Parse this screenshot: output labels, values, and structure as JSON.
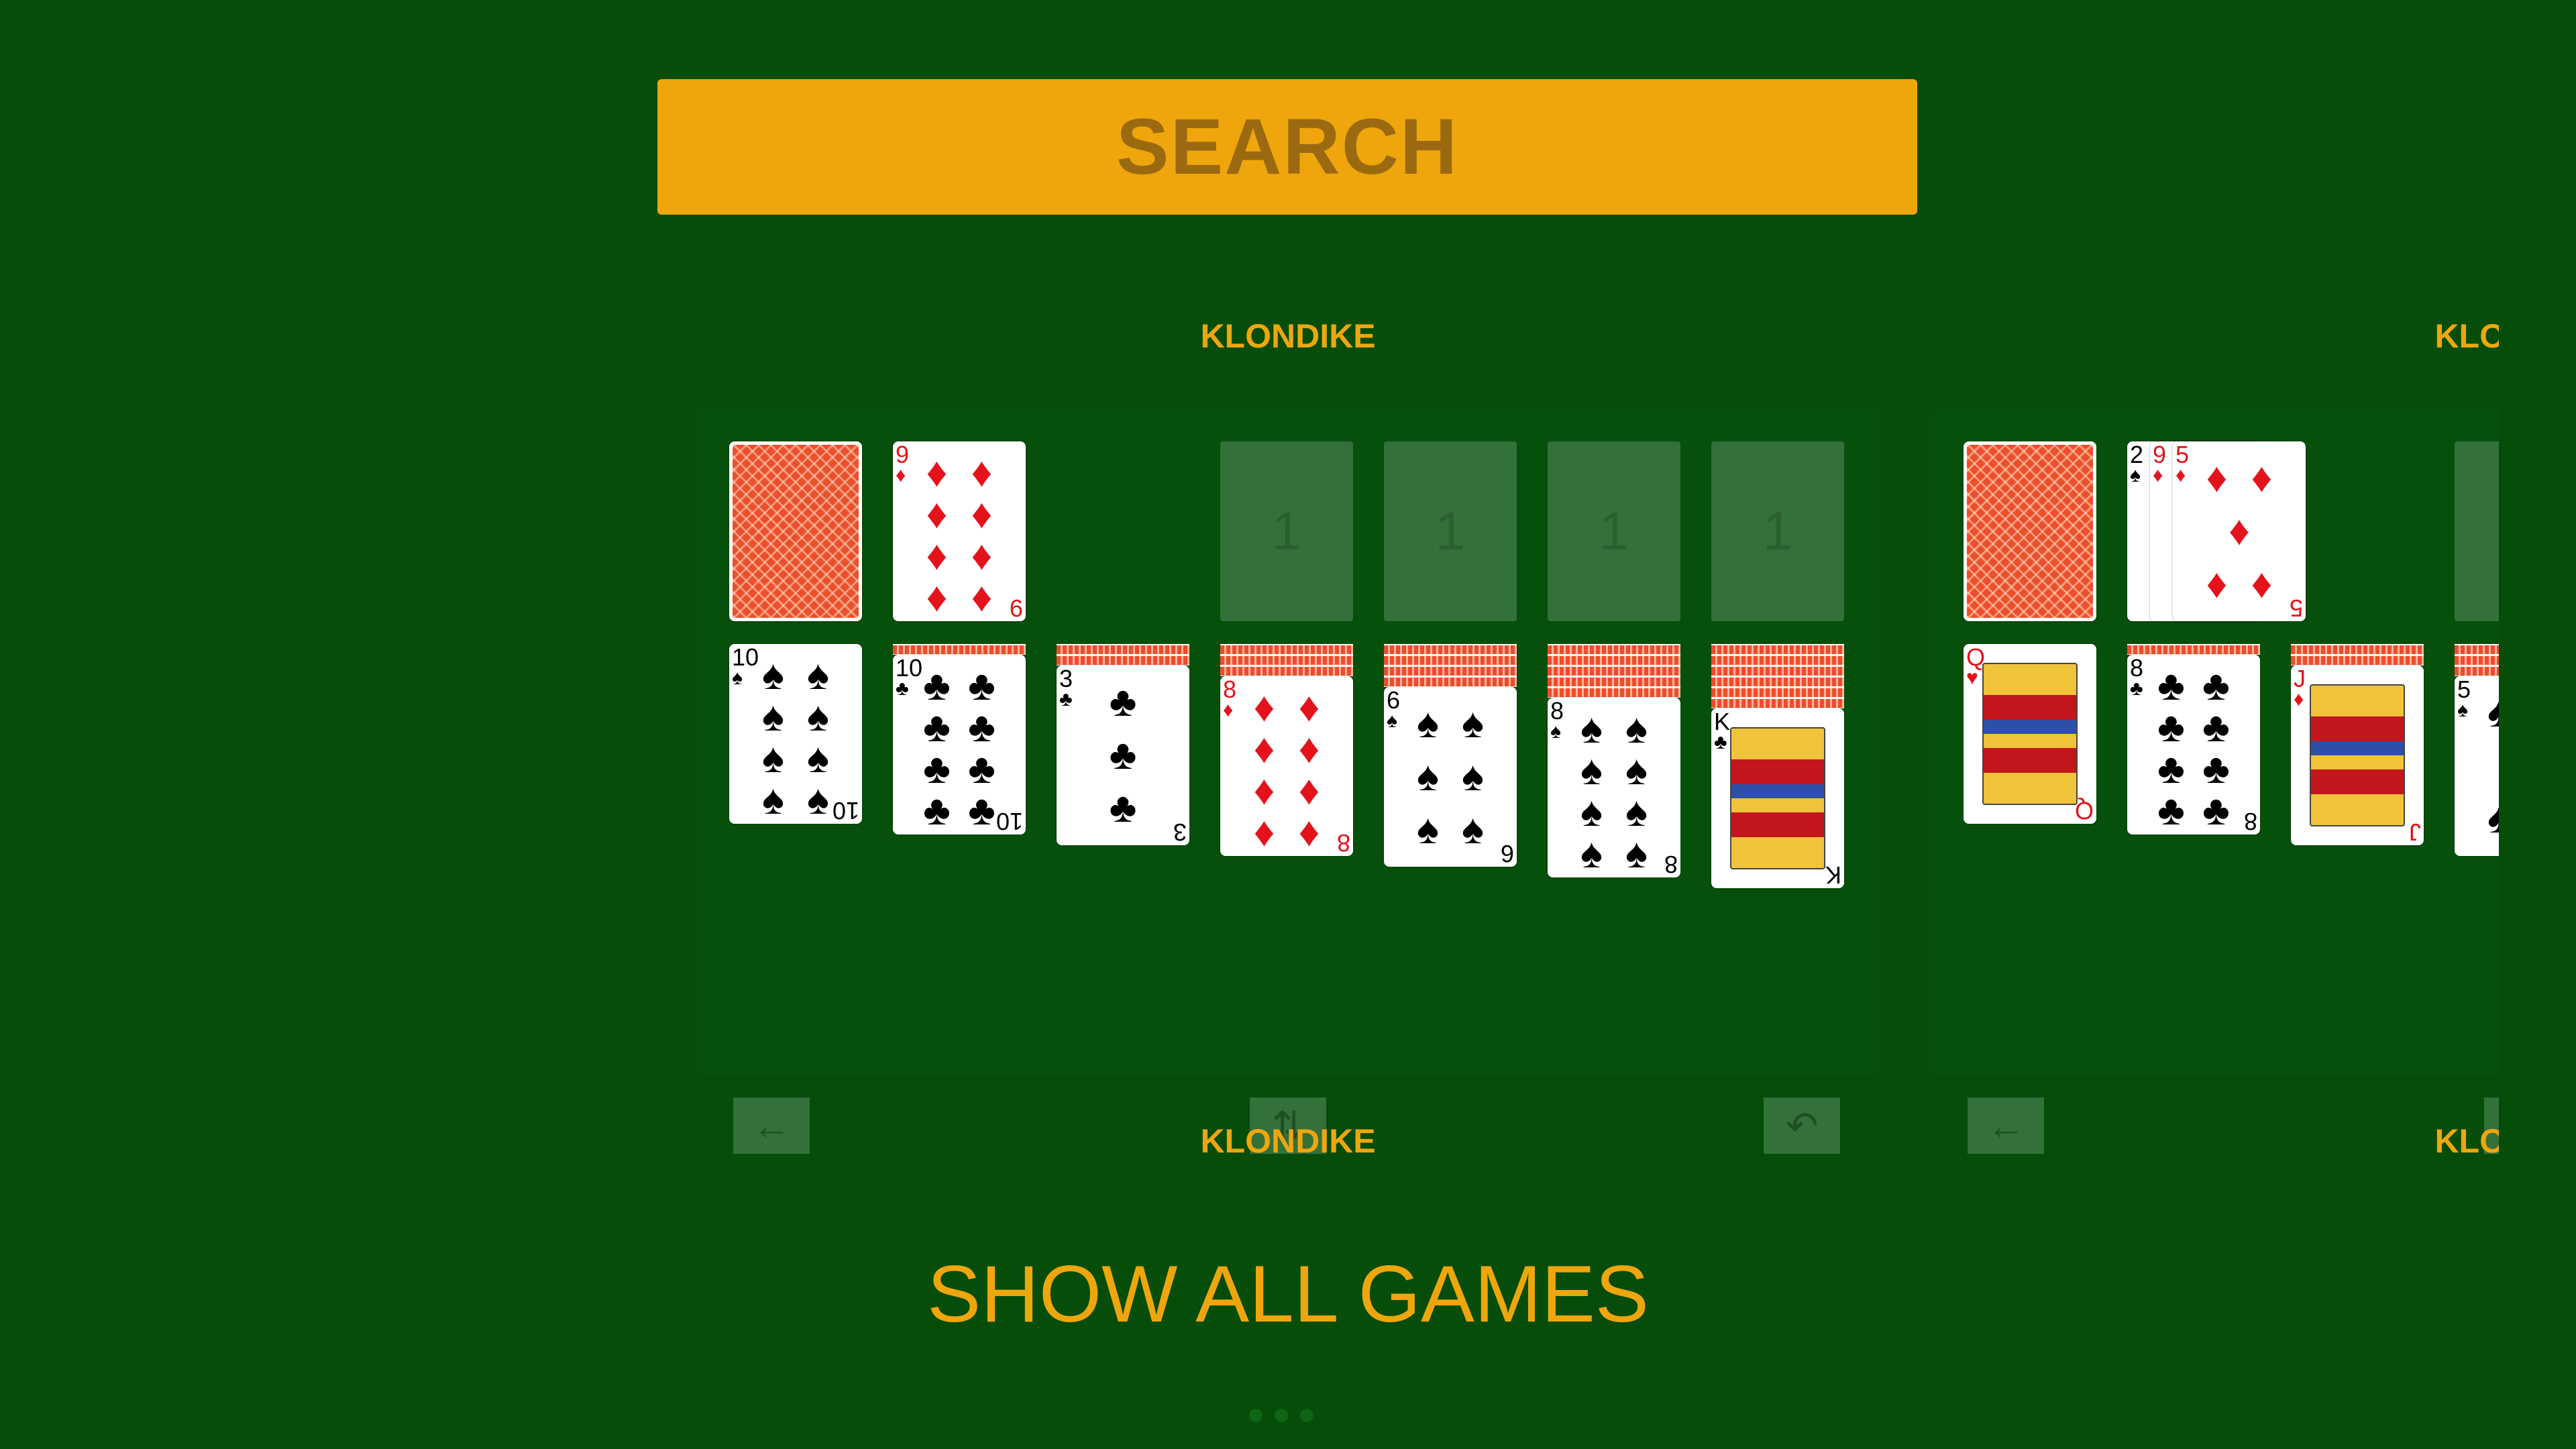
{
  "search": {
    "label": "SEARCH"
  },
  "games": [
    {
      "title_top": "KLONDIKE",
      "title_bottom": "KLONDIKE",
      "foundations": [
        "1",
        "1",
        "1",
        "1"
      ],
      "waste_top": {
        "rank": "9",
        "suit": "♦"
      },
      "tableau": [
        {
          "rank": "10",
          "suit": "♠"
        },
        {
          "rank": "10",
          "suit": "♣"
        },
        {
          "rank": "3",
          "suit": "♣"
        },
        {
          "rank": "8",
          "suit": "♦"
        },
        {
          "rank": "6",
          "suit": "♠"
        },
        {
          "rank": "8",
          "suit": "♠"
        },
        {
          "rank": "K",
          "suit": "♣"
        }
      ],
      "controls": {
        "back": "←",
        "swap": "⇅",
        "undo": "↶"
      }
    },
    {
      "title_top": "KLONDIKE",
      "title_bottom": "KLONDIKE",
      "waste": [
        {
          "rank": "2",
          "suit": "♠"
        },
        {
          "rank": "9",
          "suit": "♦"
        },
        {
          "rank": "5",
          "suit": "♦"
        }
      ],
      "tableau": [
        {
          "rank": "Q",
          "suit": "♥"
        },
        {
          "rank": "8",
          "suit": "♣"
        },
        {
          "rank": "J",
          "suit": "♦"
        },
        {
          "rank": "5",
          "suit": "♠"
        }
      ],
      "controls": {
        "back": "←"
      }
    }
  ],
  "show_all": {
    "label": "SHOW ALL GAMES"
  },
  "pager": {
    "pages": 3,
    "icon": "pagination-dots-icon"
  },
  "colors": {
    "background": "#054d08",
    "accent": "#efa60d",
    "card_back": "#eb4f2b"
  }
}
